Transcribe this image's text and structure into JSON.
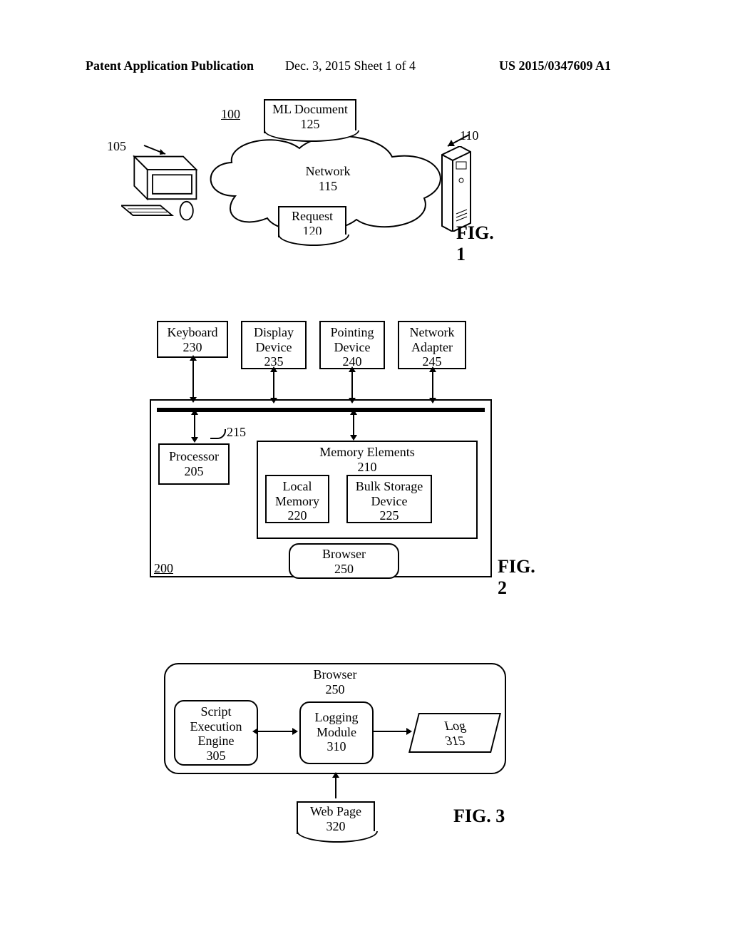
{
  "header": {
    "left": "Patent Application Publication",
    "middle": "Dec. 3, 2015   Sheet 1 of 4",
    "right": "US 2015/0347609 A1"
  },
  "fig1": {
    "title": "FIG. 1",
    "ref100": "100",
    "ref105": "105",
    "ref110": "110",
    "network": "Network",
    "network_num": "115",
    "ml_doc": "ML Document",
    "ml_doc_num": "125",
    "request": "Request",
    "request_num": "120"
  },
  "fig2": {
    "title": "FIG. 2",
    "ref200": "200",
    "ref215": "215",
    "keyboard": "Keyboard",
    "keyboard_num": "230",
    "display": "Display Device",
    "display_num": "235",
    "pointing": "Pointing Device",
    "pointing_num": "240",
    "network_adapter": "Network Adapter",
    "network_adapter_num": "245",
    "processor": "Processor",
    "processor_num": "205",
    "memory_elements": "Memory Elements",
    "memory_elements_num": "210",
    "local_memory": "Local Memory",
    "local_memory_num": "220",
    "bulk_storage": "Bulk Storage Device",
    "bulk_storage_num": "225",
    "browser": "Browser",
    "browser_num": "250"
  },
  "fig3": {
    "title": "FIG. 3",
    "browser": "Browser",
    "browser_num": "250",
    "script_engine": "Script Execution Engine",
    "script_engine_num": "305",
    "logging_module": "Logging Module",
    "logging_module_num": "310",
    "log": "Log",
    "log_num": "315",
    "webpage": "Web Page",
    "webpage_num": "320"
  }
}
